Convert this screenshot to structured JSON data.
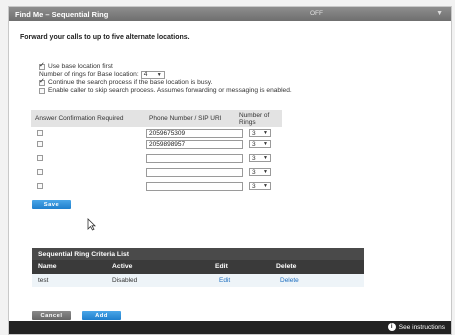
{
  "window": {
    "title": "Find Me – Sequential Ring",
    "status": "OFF",
    "chevron_icon": "chevron-down-icon"
  },
  "intro": "Forward your calls to up to five alternate locations.",
  "options": {
    "use_base_location": {
      "label": "Use base location first",
      "checked": true
    },
    "rings_label": "Number of rings for Base location:",
    "rings_value": "4",
    "continue_search": {
      "label": "Continue the search process if the base location is busy.",
      "checked": true
    },
    "enable_skip": {
      "label": "Enable caller to skip search process. Assumes forwarding or messaging is enabled.",
      "checked": false
    }
  },
  "locations": {
    "headers": {
      "confirm": "Answer Confirmation Required",
      "phone": "Phone Number / SIP URI",
      "rings": "Number of Rings"
    },
    "rows": [
      {
        "phone": "2059675309",
        "rings": "3"
      },
      {
        "phone": "2059898957",
        "rings": "3"
      },
      {
        "phone": "",
        "rings": "3"
      },
      {
        "phone": "",
        "rings": "3"
      },
      {
        "phone": "",
        "rings": "3"
      }
    ]
  },
  "save_label": "Save",
  "criteria": {
    "title": "Sequential Ring Criteria List",
    "headers": {
      "name": "Name",
      "active": "Active",
      "edit": "Edit",
      "delete": "Delete"
    },
    "rows": [
      {
        "name": "test",
        "active": "Disabled",
        "edit": "Edit",
        "delete": "Delete"
      }
    ]
  },
  "cancel_label": "Cancel",
  "add_label": "Add",
  "footer": {
    "help_label": "See instructions",
    "help_icon": "info-icon"
  }
}
